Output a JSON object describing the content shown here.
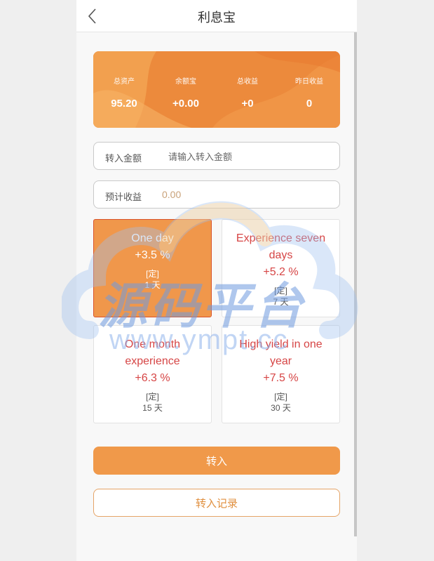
{
  "header": {
    "title": "利息宝",
    "back_icon": "chevron-left-icon"
  },
  "assets": [
    {
      "label": "总资产",
      "value": "95.20"
    },
    {
      "label": "余额宝",
      "value": "+0.00"
    },
    {
      "label": "总收益",
      "value": "+0"
    },
    {
      "label": "昨日收益",
      "value": "0"
    }
  ],
  "transfer": {
    "label": "转入金额",
    "placeholder": "请输入转入金额",
    "value": ""
  },
  "estimate": {
    "label": "预计收益",
    "value": "0.00"
  },
  "plans": [
    {
      "name": "One day",
      "rate": "+3.5 %",
      "tag": "[定]",
      "days": "1 天",
      "selected": true
    },
    {
      "name": "Experience seven days",
      "rate": "+5.2 %",
      "tag": "[定]",
      "days": "7 天",
      "selected": false
    },
    {
      "name": "One month experience",
      "rate": "+6.3 %",
      "tag": "[定]",
      "days": "15 天",
      "selected": false
    },
    {
      "name": "High yield in one year",
      "rate": "+7.5 %",
      "tag": "[定]",
      "days": "30 天",
      "selected": false
    }
  ],
  "actions": {
    "primary": "转入",
    "secondary": "转入记录"
  },
  "watermark": {
    "brand": "源码平台",
    "url": "www.ympt.cc"
  },
  "colors": {
    "accent": "#f0994a",
    "card_orange": "#ec8a3c",
    "plan_red": "#d64545",
    "selected_border": "#d9542c"
  }
}
